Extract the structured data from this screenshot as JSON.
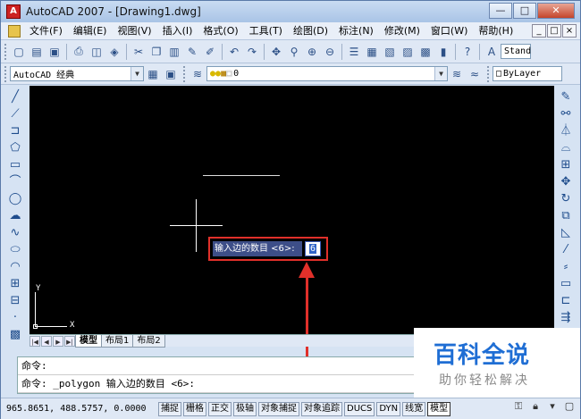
{
  "window": {
    "title": "AutoCAD 2007 - [Drawing1.dwg]",
    "app_icon_letter": "A",
    "minimize": "—",
    "maximize": "□",
    "close": "✕"
  },
  "menu": {
    "items": [
      "文件(F)",
      "编辑(E)",
      "视图(V)",
      "插入(I)",
      "格式(O)",
      "工具(T)",
      "绘图(D)",
      "标注(N)",
      "修改(M)",
      "窗口(W)",
      "帮助(H)"
    ],
    "mdi": [
      "_",
      "□",
      "×"
    ]
  },
  "toolbar2": {
    "workspace": "AutoCAD 经典",
    "layer_value": "0",
    "color_value": "ByLayer",
    "style_value": "Stand"
  },
  "drawing": {
    "ucs_x": "X",
    "ucs_y": "Y",
    "dynamic_prompt": "输入边的数目 <6>:",
    "dynamic_value": "6"
  },
  "tabs": {
    "nav": [
      "|◀",
      "◀",
      "▶",
      "▶|"
    ],
    "items": [
      "模型",
      "布局1",
      "布局2"
    ],
    "active": "模型"
  },
  "command": {
    "line1": "命令:",
    "line2": "命令: _polygon 输入边的数目 <6>:"
  },
  "status": {
    "coords": "965.8651,  488.5757, 0.0000",
    "buttons": [
      "捕捉",
      "栅格",
      "正交",
      "极轴",
      "对象捕捉",
      "对象追踪",
      "DUCS",
      "DYN",
      "线宽",
      "模型"
    ],
    "active_buttons": [
      "模型"
    ]
  },
  "watermark": {
    "title": "百科全说",
    "subtitle": "助你轻松解决"
  }
}
